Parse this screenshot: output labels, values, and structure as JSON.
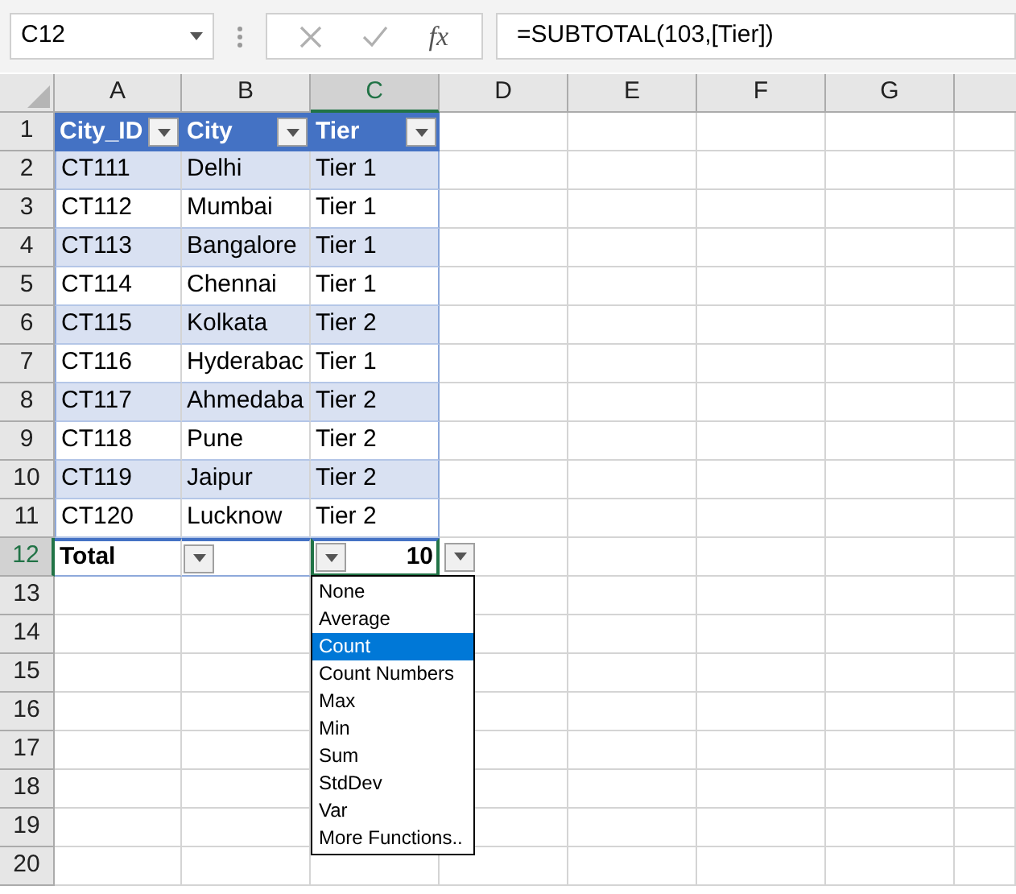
{
  "name_box": {
    "value": "C12"
  },
  "formula_bar": {
    "function_label": "fx",
    "formula": "=SUBTOTAL(103,[Tier])"
  },
  "columns": [
    {
      "label": "A",
      "selected": false
    },
    {
      "label": "B",
      "selected": false
    },
    {
      "label": "C",
      "selected": true
    },
    {
      "label": "D",
      "selected": false
    },
    {
      "label": "E",
      "selected": false
    },
    {
      "label": "F",
      "selected": false
    },
    {
      "label": "G",
      "selected": false
    }
  ],
  "row_headers": [
    {
      "label": "1",
      "selected": false
    },
    {
      "label": "2",
      "selected": false
    },
    {
      "label": "3",
      "selected": false
    },
    {
      "label": "4",
      "selected": false
    },
    {
      "label": "5",
      "selected": false
    },
    {
      "label": "6",
      "selected": false
    },
    {
      "label": "7",
      "selected": false
    },
    {
      "label": "8",
      "selected": false
    },
    {
      "label": "9",
      "selected": false
    },
    {
      "label": "10",
      "selected": false
    },
    {
      "label": "11",
      "selected": false
    },
    {
      "label": "12",
      "selected": true
    },
    {
      "label": "13",
      "selected": false
    },
    {
      "label": "14",
      "selected": false
    },
    {
      "label": "15",
      "selected": false
    },
    {
      "label": "16",
      "selected": false
    },
    {
      "label": "17",
      "selected": false
    },
    {
      "label": "18",
      "selected": false
    },
    {
      "label": "19",
      "selected": false
    },
    {
      "label": "20",
      "selected": false
    }
  ],
  "table": {
    "headers": [
      "City_ID",
      "City",
      "Tier"
    ],
    "rows": [
      [
        "CT111",
        "Delhi",
        "Tier 1"
      ],
      [
        "CT112",
        "Mumbai",
        "Tier 1"
      ],
      [
        "CT113",
        "Bangalore",
        "Tier 1"
      ],
      [
        "CT114",
        "Chennai",
        "Tier 1"
      ],
      [
        "CT115",
        "Kolkata",
        "Tier 2"
      ],
      [
        "CT116",
        "Hyderabac",
        "Tier 1"
      ],
      [
        "CT117",
        "Ahmedaba",
        "Tier 2"
      ],
      [
        "CT118",
        "Pune",
        "Tier 2"
      ],
      [
        "CT119",
        "Jaipur",
        "Tier 2"
      ],
      [
        "CT120",
        "Lucknow",
        "Tier 2"
      ]
    ],
    "total": {
      "label": "Total",
      "value": "10"
    }
  },
  "total_menu": {
    "items": [
      {
        "label": "None",
        "selected": false
      },
      {
        "label": "Average",
        "selected": false
      },
      {
        "label": "Count",
        "selected": true
      },
      {
        "label": "Count Numbers",
        "selected": false
      },
      {
        "label": "Max",
        "selected": false
      },
      {
        "label": "Min",
        "selected": false
      },
      {
        "label": "Sum",
        "selected": false
      },
      {
        "label": "StdDev",
        "selected": false
      },
      {
        "label": "Var",
        "selected": false
      },
      {
        "label": "More Functions..",
        "selected": false
      }
    ]
  }
}
